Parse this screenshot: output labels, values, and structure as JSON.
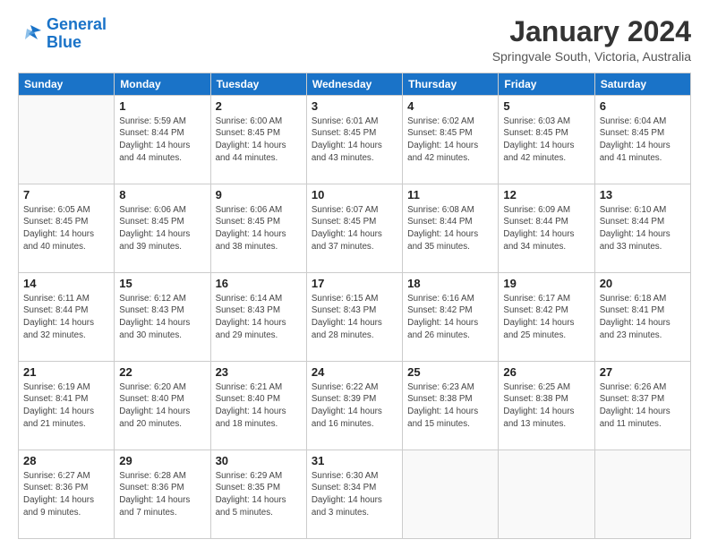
{
  "logo": {
    "line1": "General",
    "line2": "Blue"
  },
  "title": "January 2024",
  "subtitle": "Springvale South, Victoria, Australia",
  "days_header": [
    "Sunday",
    "Monday",
    "Tuesday",
    "Wednesday",
    "Thursday",
    "Friday",
    "Saturday"
  ],
  "weeks": [
    [
      {
        "day": "",
        "info": ""
      },
      {
        "day": "1",
        "info": "Sunrise: 5:59 AM\nSunset: 8:44 PM\nDaylight: 14 hours\nand 44 minutes."
      },
      {
        "day": "2",
        "info": "Sunrise: 6:00 AM\nSunset: 8:45 PM\nDaylight: 14 hours\nand 44 minutes."
      },
      {
        "day": "3",
        "info": "Sunrise: 6:01 AM\nSunset: 8:45 PM\nDaylight: 14 hours\nand 43 minutes."
      },
      {
        "day": "4",
        "info": "Sunrise: 6:02 AM\nSunset: 8:45 PM\nDaylight: 14 hours\nand 42 minutes."
      },
      {
        "day": "5",
        "info": "Sunrise: 6:03 AM\nSunset: 8:45 PM\nDaylight: 14 hours\nand 42 minutes."
      },
      {
        "day": "6",
        "info": "Sunrise: 6:04 AM\nSunset: 8:45 PM\nDaylight: 14 hours\nand 41 minutes."
      }
    ],
    [
      {
        "day": "7",
        "info": "Sunrise: 6:05 AM\nSunset: 8:45 PM\nDaylight: 14 hours\nand 40 minutes."
      },
      {
        "day": "8",
        "info": "Sunrise: 6:06 AM\nSunset: 8:45 PM\nDaylight: 14 hours\nand 39 minutes."
      },
      {
        "day": "9",
        "info": "Sunrise: 6:06 AM\nSunset: 8:45 PM\nDaylight: 14 hours\nand 38 minutes."
      },
      {
        "day": "10",
        "info": "Sunrise: 6:07 AM\nSunset: 8:45 PM\nDaylight: 14 hours\nand 37 minutes."
      },
      {
        "day": "11",
        "info": "Sunrise: 6:08 AM\nSunset: 8:44 PM\nDaylight: 14 hours\nand 35 minutes."
      },
      {
        "day": "12",
        "info": "Sunrise: 6:09 AM\nSunset: 8:44 PM\nDaylight: 14 hours\nand 34 minutes."
      },
      {
        "day": "13",
        "info": "Sunrise: 6:10 AM\nSunset: 8:44 PM\nDaylight: 14 hours\nand 33 minutes."
      }
    ],
    [
      {
        "day": "14",
        "info": "Sunrise: 6:11 AM\nSunset: 8:44 PM\nDaylight: 14 hours\nand 32 minutes."
      },
      {
        "day": "15",
        "info": "Sunrise: 6:12 AM\nSunset: 8:43 PM\nDaylight: 14 hours\nand 30 minutes."
      },
      {
        "day": "16",
        "info": "Sunrise: 6:14 AM\nSunset: 8:43 PM\nDaylight: 14 hours\nand 29 minutes."
      },
      {
        "day": "17",
        "info": "Sunrise: 6:15 AM\nSunset: 8:43 PM\nDaylight: 14 hours\nand 28 minutes."
      },
      {
        "day": "18",
        "info": "Sunrise: 6:16 AM\nSunset: 8:42 PM\nDaylight: 14 hours\nand 26 minutes."
      },
      {
        "day": "19",
        "info": "Sunrise: 6:17 AM\nSunset: 8:42 PM\nDaylight: 14 hours\nand 25 minutes."
      },
      {
        "day": "20",
        "info": "Sunrise: 6:18 AM\nSunset: 8:41 PM\nDaylight: 14 hours\nand 23 minutes."
      }
    ],
    [
      {
        "day": "21",
        "info": "Sunrise: 6:19 AM\nSunset: 8:41 PM\nDaylight: 14 hours\nand 21 minutes."
      },
      {
        "day": "22",
        "info": "Sunrise: 6:20 AM\nSunset: 8:40 PM\nDaylight: 14 hours\nand 20 minutes."
      },
      {
        "day": "23",
        "info": "Sunrise: 6:21 AM\nSunset: 8:40 PM\nDaylight: 14 hours\nand 18 minutes."
      },
      {
        "day": "24",
        "info": "Sunrise: 6:22 AM\nSunset: 8:39 PM\nDaylight: 14 hours\nand 16 minutes."
      },
      {
        "day": "25",
        "info": "Sunrise: 6:23 AM\nSunset: 8:38 PM\nDaylight: 14 hours\nand 15 minutes."
      },
      {
        "day": "26",
        "info": "Sunrise: 6:25 AM\nSunset: 8:38 PM\nDaylight: 14 hours\nand 13 minutes."
      },
      {
        "day": "27",
        "info": "Sunrise: 6:26 AM\nSunset: 8:37 PM\nDaylight: 14 hours\nand 11 minutes."
      }
    ],
    [
      {
        "day": "28",
        "info": "Sunrise: 6:27 AM\nSunset: 8:36 PM\nDaylight: 14 hours\nand 9 minutes."
      },
      {
        "day": "29",
        "info": "Sunrise: 6:28 AM\nSunset: 8:36 PM\nDaylight: 14 hours\nand 7 minutes."
      },
      {
        "day": "30",
        "info": "Sunrise: 6:29 AM\nSunset: 8:35 PM\nDaylight: 14 hours\nand 5 minutes."
      },
      {
        "day": "31",
        "info": "Sunrise: 6:30 AM\nSunset: 8:34 PM\nDaylight: 14 hours\nand 3 minutes."
      },
      {
        "day": "",
        "info": ""
      },
      {
        "day": "",
        "info": ""
      },
      {
        "day": "",
        "info": ""
      }
    ]
  ]
}
